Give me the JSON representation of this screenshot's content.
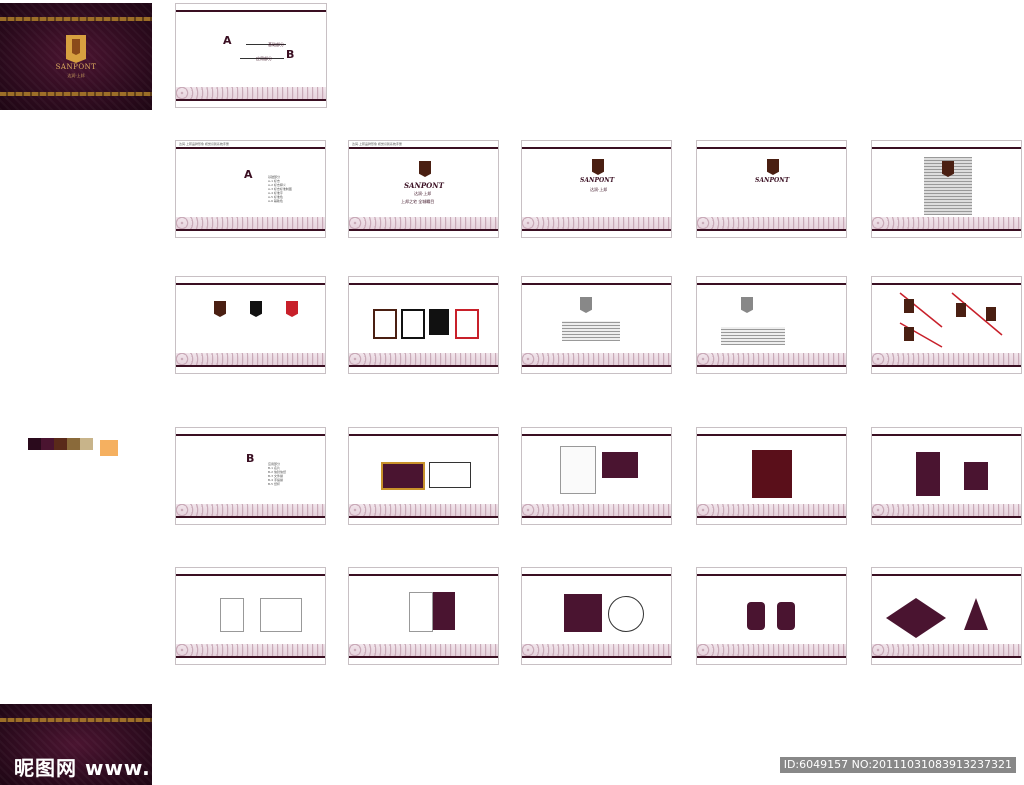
{
  "covers": {
    "brand": "SANPONT",
    "sub": "达润·上邦"
  },
  "cover_slide": {
    "letter_a": "A",
    "letter_b": "B",
    "line_a": "基础部分",
    "line_b": "应用部分"
  },
  "slides": {
    "section_a_letter": "A",
    "section_b_letter": "B",
    "wordmark": "SANPONT",
    "cn_name": "达润·上邦",
    "tagline": "上邦之宅  全城瞩目",
    "header": "达润·上邦品牌形象 视觉识别系统手册",
    "toc_a": [
      "基础部分",
      "A-1 标志",
      "A-2 标志释义",
      "A-3 标志标准制图",
      "A-4 标准字",
      "A-5 标准色",
      "A-6 辅助色",
      "A-7 组合规范",
      "A-8 错误范例"
    ],
    "toc_b": [
      "应用部分",
      "B-1 名片",
      "B-2 信封信纸",
      "B-3 文件袋",
      "B-4 手提袋",
      "B-5 纸杯",
      "B-6 工作证",
      "B-7 光盘"
    ]
  },
  "watermark": {
    "left": "昵图网 www.nipic.com",
    "right": "ID:6049157 NO:20111031083913237321"
  },
  "colors": {
    "brand_dark": "#3a0f22",
    "brand_brown": "#4a1f12",
    "accent_gold": "#b8862a",
    "swatches": [
      "#2a0a1c",
      "#4a1430",
      "#5a2a1a",
      "#8a6a3a",
      "#c8b48a",
      "#f0e2c6",
      "#f5b060"
    ]
  }
}
